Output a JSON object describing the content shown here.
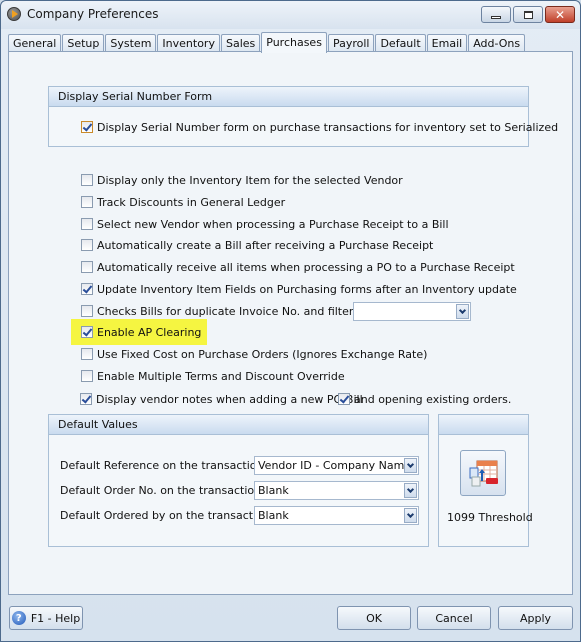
{
  "window": {
    "title": "Company Preferences",
    "controls": {
      "minimize": "minimize",
      "maximize": "maximize",
      "close": "✕"
    }
  },
  "tabs": [
    {
      "label": "General",
      "active": false
    },
    {
      "label": "Setup",
      "active": false
    },
    {
      "label": "System",
      "active": false
    },
    {
      "label": "Inventory",
      "active": false
    },
    {
      "label": "Sales",
      "active": false
    },
    {
      "label": "Purchases",
      "active": true
    },
    {
      "label": "Payroll",
      "active": false
    },
    {
      "label": "Default",
      "active": false
    },
    {
      "label": "Email",
      "active": false
    },
    {
      "label": "Add-Ons",
      "active": false
    }
  ],
  "serial_group": {
    "title": "Display Serial Number Form",
    "option": {
      "label": "Display Serial Number form on purchase transactions for inventory set to Serialized",
      "checked": true
    }
  },
  "options": [
    {
      "label": "Display only the Inventory Item for the selected Vendor",
      "checked": false
    },
    {
      "label": "Track Discounts in General Ledger",
      "checked": false
    },
    {
      "label": "Select new Vendor when processing a Purchase Receipt to a Bill",
      "checked": false
    },
    {
      "label": "Automatically create a Bill after receiving a Purchase Receipt",
      "checked": false
    },
    {
      "label": "Automatically receive all items when processing a PO to a Purchase Receipt",
      "checked": false
    },
    {
      "label": "Update Inventory Item Fields on Purchasing forms after an Inventory update",
      "checked": true
    },
    {
      "label": "Checks Bills for duplicate Invoice No. and filtered by:",
      "checked": false
    },
    {
      "label": "Enable AP Clearing",
      "checked": true,
      "highlighted": true
    },
    {
      "label": "Use Fixed Cost on Purchase Orders (Ignores Exchange Rate)",
      "checked": false
    },
    {
      "label": "Enable Multiple Terms and Discount Override",
      "checked": false
    },
    {
      "label": "Display vendor notes when adding a new PO\\Bill",
      "checked": true
    },
    {
      "label": "and opening existing orders.",
      "checked": true
    }
  ],
  "duplicate_filter": {
    "value": ""
  },
  "default_values": {
    "title": "Default Values",
    "fields": [
      {
        "label": "Default Reference on the transactions",
        "value": "Vendor ID - Company Name"
      },
      {
        "label": "Default Order No. on the transactions",
        "value": "Blank"
      },
      {
        "label": "Default Ordered by on the transactions",
        "value": "Blank"
      }
    ]
  },
  "threshold": {
    "label": "1099 Threshold",
    "icon": "calendar-upload-icon"
  },
  "footer": {
    "help_label": "F1 - Help",
    "ok_label": "OK",
    "cancel_label": "Cancel",
    "apply_label": "Apply"
  },
  "colors": {
    "highlight": "#f5f541",
    "group_header": "#c9dbef",
    "check_mark": "#2a4e9a"
  }
}
